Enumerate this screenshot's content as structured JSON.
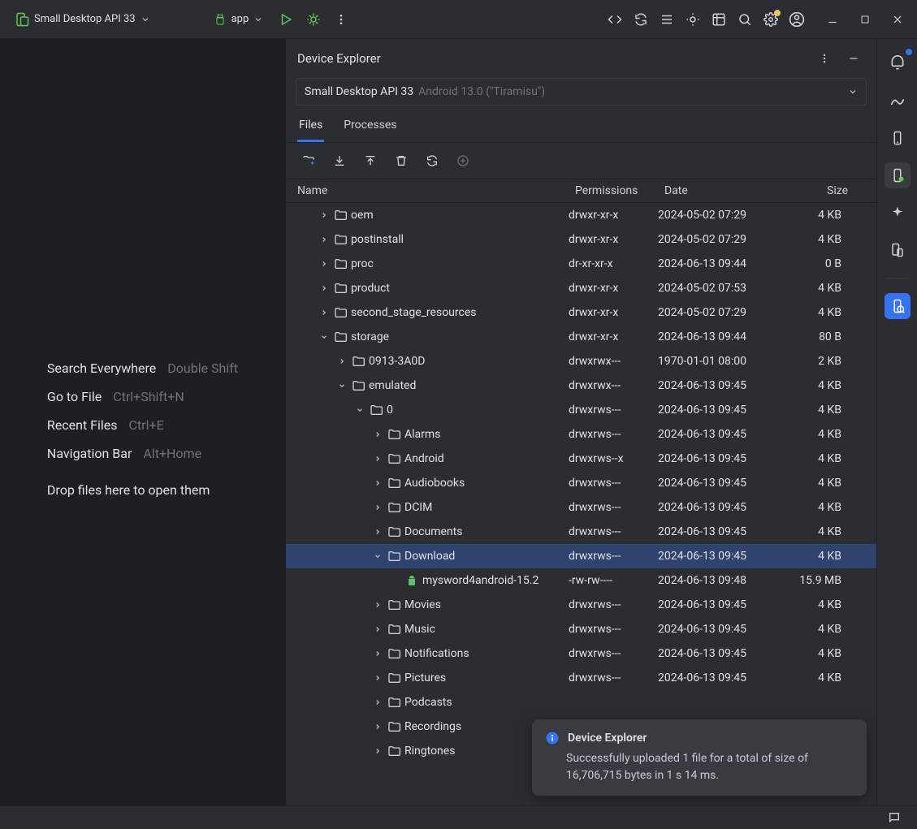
{
  "titlebar": {
    "device_label": "Small Desktop API 33",
    "run_config_label": "app"
  },
  "editor_hints": [
    {
      "label": "Search Everywhere",
      "key": "Double Shift"
    },
    {
      "label": "Go to File",
      "key": "Ctrl+Shift+N"
    },
    {
      "label": "Recent Files",
      "key": "Ctrl+E"
    },
    {
      "label": "Navigation Bar",
      "key": "Alt+Home"
    }
  ],
  "editor_drop_hint": "Drop files here to open them",
  "device_explorer": {
    "title": "Device Explorer",
    "selected_device": {
      "name": "Small Desktop API 33",
      "os": "Android 13.0 (\"Tiramisu\")"
    },
    "tabs": [
      "Files",
      "Processes"
    ],
    "active_tab": "Files",
    "columns": [
      "Name",
      "Permissions",
      "Date",
      "Size"
    ],
    "rows": [
      {
        "indent": 1,
        "tw": "r",
        "ic": "folder",
        "name": "oem",
        "perm": "drwxr-xr-x",
        "date": "2024-05-02 07:29",
        "size": "4 KB"
      },
      {
        "indent": 1,
        "tw": "r",
        "ic": "folder",
        "name": "postinstall",
        "perm": "drwxr-xr-x",
        "date": "2024-05-02 07:29",
        "size": "4 KB"
      },
      {
        "indent": 1,
        "tw": "r",
        "ic": "folder",
        "name": "proc",
        "perm": "dr-xr-xr-x",
        "date": "2024-06-13 09:44",
        "size": "0 B"
      },
      {
        "indent": 1,
        "tw": "r",
        "ic": "folder",
        "name": "product",
        "perm": "drwxr-xr-x",
        "date": "2024-05-02 07:53",
        "size": "4 KB"
      },
      {
        "indent": 1,
        "tw": "r",
        "ic": "folder",
        "name": "second_stage_resources",
        "perm": "drwxr-xr-x",
        "date": "2024-05-02 07:29",
        "size": "4 KB"
      },
      {
        "indent": 1,
        "tw": "d",
        "ic": "folder",
        "name": "storage",
        "perm": "drwxr-xr-x",
        "date": "2024-06-13 09:44",
        "size": "80 B"
      },
      {
        "indent": 2,
        "tw": "r",
        "ic": "folder",
        "name": "0913-3A0D",
        "perm": "drwxrwx---",
        "date": "1970-01-01 08:00",
        "size": "2 KB"
      },
      {
        "indent": 2,
        "tw": "d",
        "ic": "folder",
        "name": "emulated",
        "perm": "drwxrwx---",
        "date": "2024-06-13 09:45",
        "size": "4 KB"
      },
      {
        "indent": 3,
        "tw": "d",
        "ic": "folder",
        "name": "0",
        "perm": "drwxrws---",
        "date": "2024-06-13 09:45",
        "size": "4 KB"
      },
      {
        "indent": 4,
        "tw": "r",
        "ic": "folder",
        "name": "Alarms",
        "perm": "drwxrws---",
        "date": "2024-06-13 09:45",
        "size": "4 KB"
      },
      {
        "indent": 4,
        "tw": "r",
        "ic": "folder",
        "name": "Android",
        "perm": "drwxrws--x",
        "date": "2024-06-13 09:45",
        "size": "4 KB"
      },
      {
        "indent": 4,
        "tw": "r",
        "ic": "folder",
        "name": "Audiobooks",
        "perm": "drwxrws---",
        "date": "2024-06-13 09:45",
        "size": "4 KB"
      },
      {
        "indent": 4,
        "tw": "r",
        "ic": "folder",
        "name": "DCIM",
        "perm": "drwxrws---",
        "date": "2024-06-13 09:45",
        "size": "4 KB"
      },
      {
        "indent": 4,
        "tw": "r",
        "ic": "folder",
        "name": "Documents",
        "perm": "drwxrws---",
        "date": "2024-06-13 09:45",
        "size": "4 KB"
      },
      {
        "indent": 4,
        "tw": "d",
        "ic": "folder",
        "name": "Download",
        "perm": "drwxrws---",
        "date": "2024-06-13 09:45",
        "size": "4 KB",
        "sel": true
      },
      {
        "indent": 5,
        "tw": "",
        "ic": "file",
        "name": "mysword4android-15.2",
        "perm": "-rw-rw----",
        "date": "2024-06-13 09:48",
        "size": "15.9 MB"
      },
      {
        "indent": 4,
        "tw": "r",
        "ic": "folder",
        "name": "Movies",
        "perm": "drwxrws---",
        "date": "2024-06-13 09:45",
        "size": "4 KB"
      },
      {
        "indent": 4,
        "tw": "r",
        "ic": "folder",
        "name": "Music",
        "perm": "drwxrws---",
        "date": "2024-06-13 09:45",
        "size": "4 KB"
      },
      {
        "indent": 4,
        "tw": "r",
        "ic": "folder",
        "name": "Notifications",
        "perm": "drwxrws---",
        "date": "2024-06-13 09:45",
        "size": "4 KB"
      },
      {
        "indent": 4,
        "tw": "r",
        "ic": "folder",
        "name": "Pictures",
        "perm": "drwxrws---",
        "date": "2024-06-13 09:45",
        "size": "4 KB"
      },
      {
        "indent": 4,
        "tw": "r",
        "ic": "folder",
        "name": "Podcasts",
        "perm": "",
        "date": "",
        "size": ""
      },
      {
        "indent": 4,
        "tw": "r",
        "ic": "folder",
        "name": "Recordings",
        "perm": "",
        "date": "",
        "size": ""
      },
      {
        "indent": 4,
        "tw": "r",
        "ic": "folder",
        "name": "Ringtones",
        "perm": "",
        "date": "",
        "size": ""
      }
    ]
  },
  "toast": {
    "title": "Device Explorer",
    "body": "Successfully uploaded 1 file for a total of size of 16,706,715 bytes in 1 s 14 ms."
  }
}
